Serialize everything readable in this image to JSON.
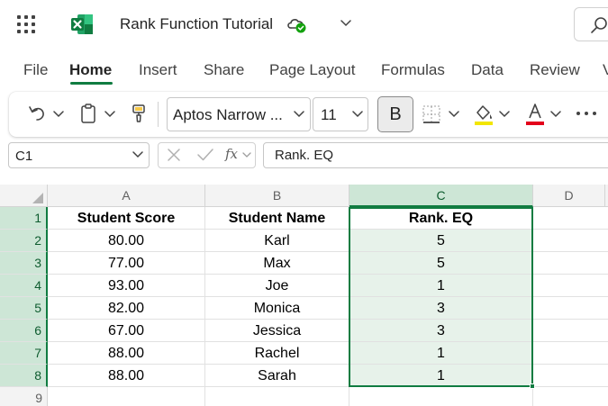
{
  "window": {
    "title": "Rank Function Tutorial"
  },
  "menu": {
    "tabs": [
      "File",
      "Home",
      "Insert",
      "Share",
      "Page Layout",
      "Formulas",
      "Data",
      "Review",
      "V"
    ],
    "active": "Home"
  },
  "ribbon": {
    "font_name": "Aptos Narrow ...",
    "font_size": "11",
    "bold_label": "B",
    "fill_color": "#f2e600",
    "font_color": "#e3001b"
  },
  "formula_bar": {
    "name_box": "C1",
    "fx_label": "fx",
    "formula": "Rank. EQ"
  },
  "sheet": {
    "columns": [
      "A",
      "B",
      "C",
      "D"
    ],
    "rows": [
      "1",
      "2",
      "3",
      "4",
      "5",
      "6",
      "7",
      "8",
      "9"
    ],
    "header": [
      "Student Score",
      "Student Name",
      "Rank. EQ"
    ],
    "data": [
      [
        "80.00",
        "Karl",
        "5"
      ],
      [
        "77.00",
        "Max",
        "5"
      ],
      [
        "93.00",
        "Joe",
        "1"
      ],
      [
        "82.00",
        "Monica",
        "3"
      ],
      [
        "67.00",
        "Jessica",
        "3"
      ],
      [
        "88.00",
        "Rachel",
        "1"
      ],
      [
        "88.00",
        "Sarah",
        "1"
      ]
    ],
    "selected_range": "C1:C8"
  },
  "colors": {
    "accent": "#107c41",
    "selection_fill": "#e7f2ea",
    "header_selected": "#cde6d6"
  }
}
